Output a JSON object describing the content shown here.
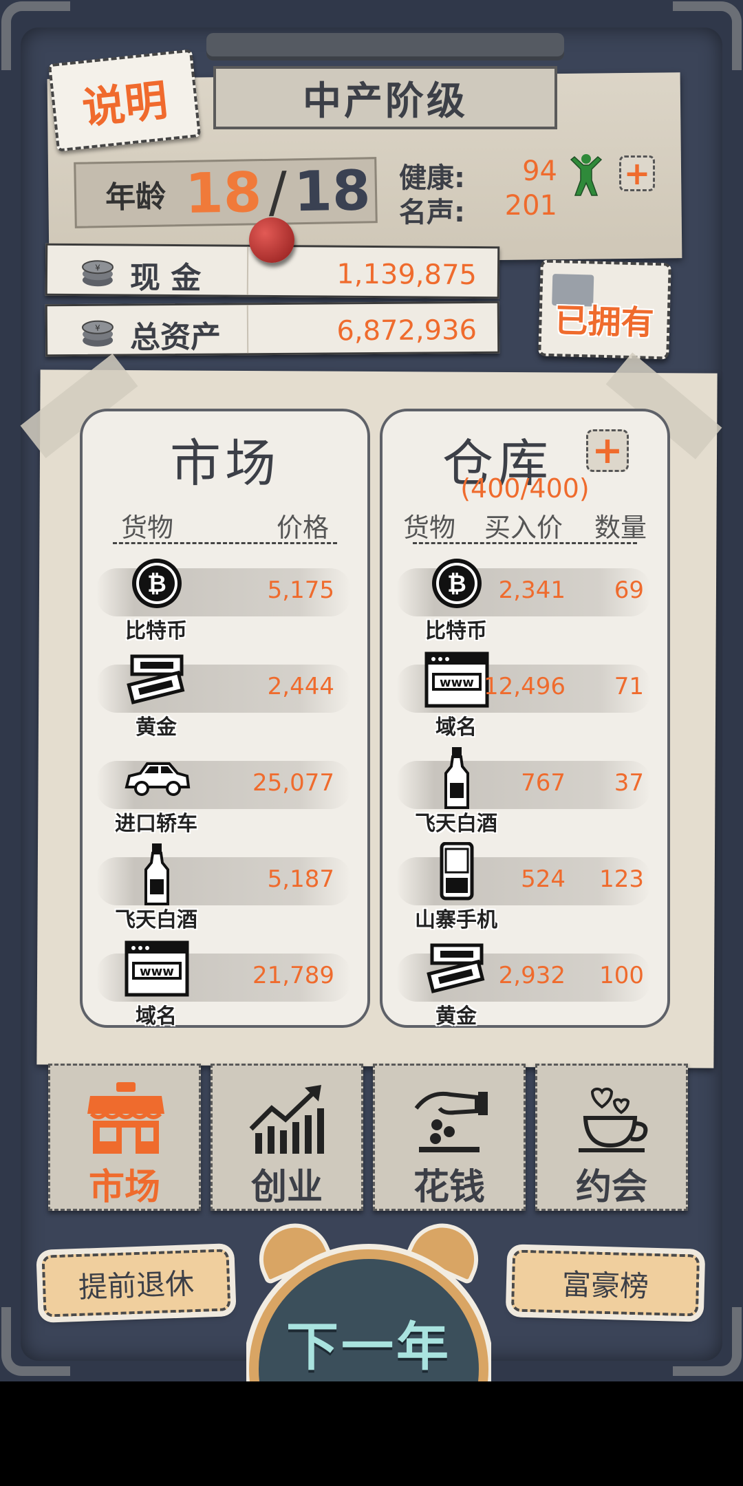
{
  "header": {
    "help_label": "说明",
    "class_title": "中产阶级",
    "age_label": "年龄",
    "age_current": "18",
    "age_separator": "/",
    "age_max": "18",
    "health_label": "健康:",
    "health_value": "94",
    "fame_label": "名声:",
    "fame_value": "201"
  },
  "money": {
    "cash_label": "现  金",
    "cash_value": "1,139,875",
    "assets_label": "总资产",
    "assets_value": "6,872,936",
    "owned_label": "已拥有"
  },
  "market": {
    "title": "市场",
    "col_goods": "货物",
    "col_price": "价格",
    "items": [
      {
        "name": "比特币",
        "price": "5,175",
        "icon": "bitcoin-icon"
      },
      {
        "name": "黄金",
        "price": "2,444",
        "icon": "gold-bar-icon"
      },
      {
        "name": "进口轿车",
        "price": "25,077",
        "icon": "car-icon"
      },
      {
        "name": "飞天白酒",
        "price": "5,187",
        "icon": "liquor-bottle-icon"
      },
      {
        "name": "域名",
        "price": "21,789",
        "icon": "domain-www-icon"
      }
    ]
  },
  "storage": {
    "title": "仓库",
    "capacity": "(400/400)",
    "col_goods": "货物",
    "col_buy_price": "买入价",
    "col_qty": "数量",
    "items": [
      {
        "name": "比特币",
        "buy_price": "2,341",
        "qty": "69",
        "icon": "bitcoin-icon"
      },
      {
        "name": "域名",
        "buy_price": "12,496",
        "qty": "71",
        "icon": "domain-www-icon"
      },
      {
        "name": "飞天白酒",
        "buy_price": "767",
        "qty": "37",
        "icon": "liquor-bottle-icon"
      },
      {
        "name": "山寨手机",
        "buy_price": "524",
        "qty": "123",
        "icon": "phone-icon"
      },
      {
        "name": "黄金",
        "buy_price": "2,932",
        "qty": "100",
        "icon": "gold-bar-icon"
      }
    ]
  },
  "nav": {
    "tabs": [
      {
        "label": "市场",
        "icon": "shop-icon",
        "active": true
      },
      {
        "label": "创业",
        "icon": "growth-chart-icon",
        "active": false
      },
      {
        "label": "花钱",
        "icon": "spend-coins-icon",
        "active": false
      },
      {
        "label": "约会",
        "icon": "coffee-hearts-icon",
        "active": false
      }
    ]
  },
  "actions": {
    "retire_label": "提前退休",
    "rank_label": "富豪榜",
    "next_year_label": "下一年"
  },
  "colors": {
    "accent": "#ef6b2d",
    "board": "#3b4458",
    "paper": "#e4ddcf",
    "clock": "#3b4f5b"
  }
}
